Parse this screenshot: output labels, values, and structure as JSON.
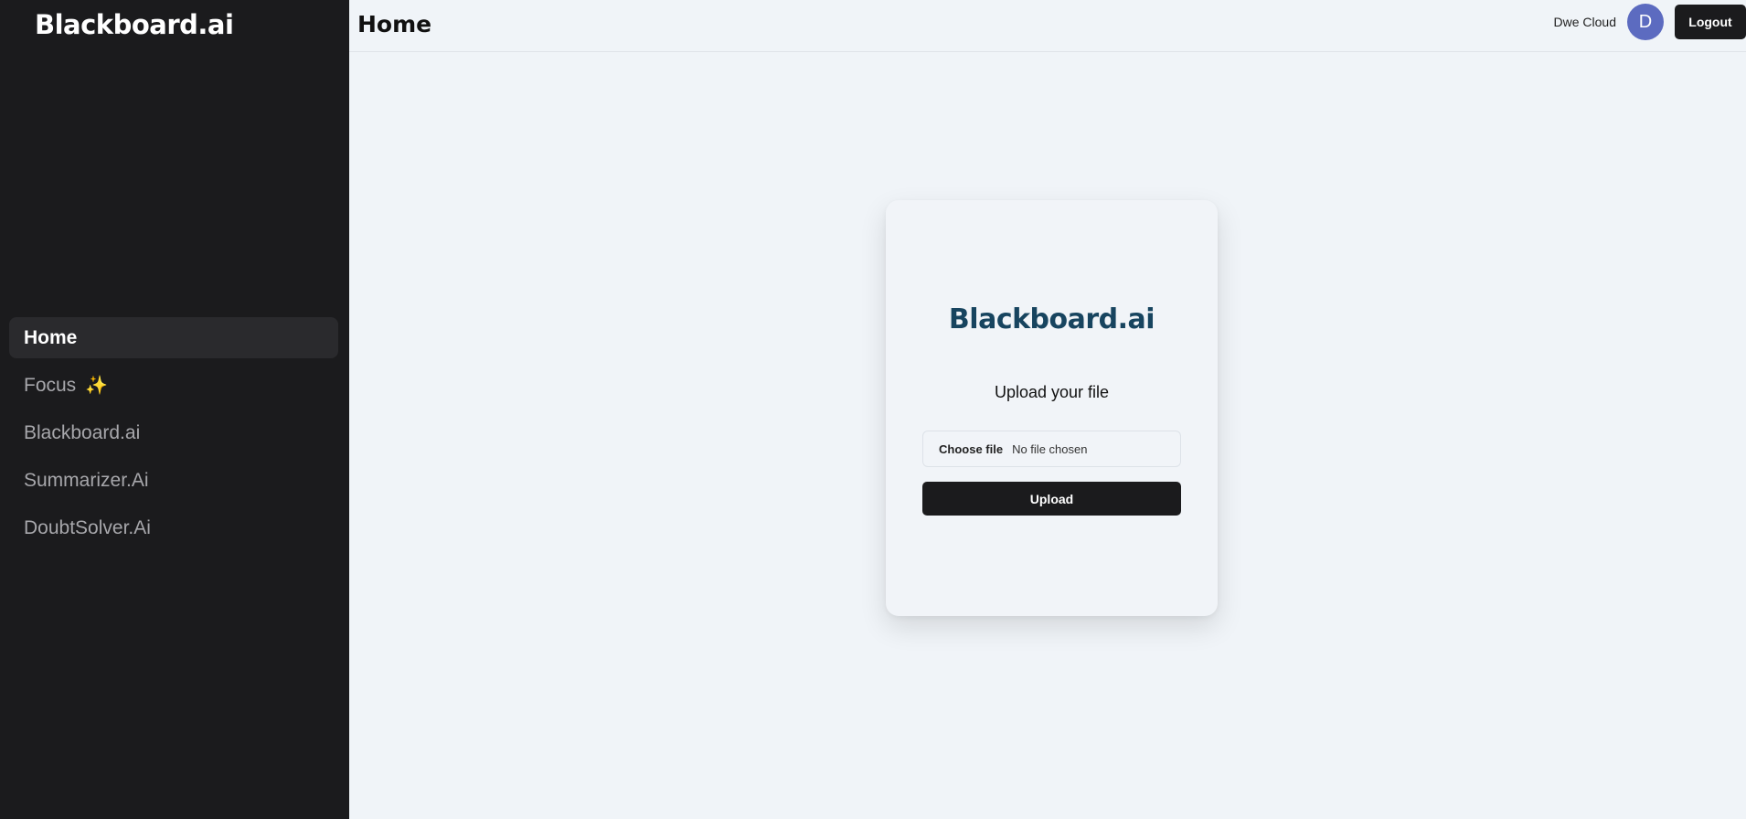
{
  "sidebar": {
    "brand": "Blackboard.ai",
    "items": [
      {
        "label": "Home",
        "active": true
      },
      {
        "label": "Focus",
        "emoji": "✨"
      },
      {
        "label": "Blackboard.ai"
      },
      {
        "label": "Summarizer.Ai"
      },
      {
        "label": "DoubtSolver.Ai"
      }
    ]
  },
  "header": {
    "title": "Home",
    "user_name": "Dwe Cloud",
    "avatar_initial": "D",
    "logout_label": "Logout"
  },
  "upload_card": {
    "logo": "Blackboard.ai",
    "subtitle": "Upload your file",
    "choose_file_label": "Choose file",
    "file_status": "No file chosen",
    "upload_label": "Upload"
  },
  "colors": {
    "sidebar_bg": "#1b1b1d",
    "page_bg": "#f0f4f8",
    "logo_accent": "#17445f",
    "avatar_bg": "#5c6bc0"
  }
}
